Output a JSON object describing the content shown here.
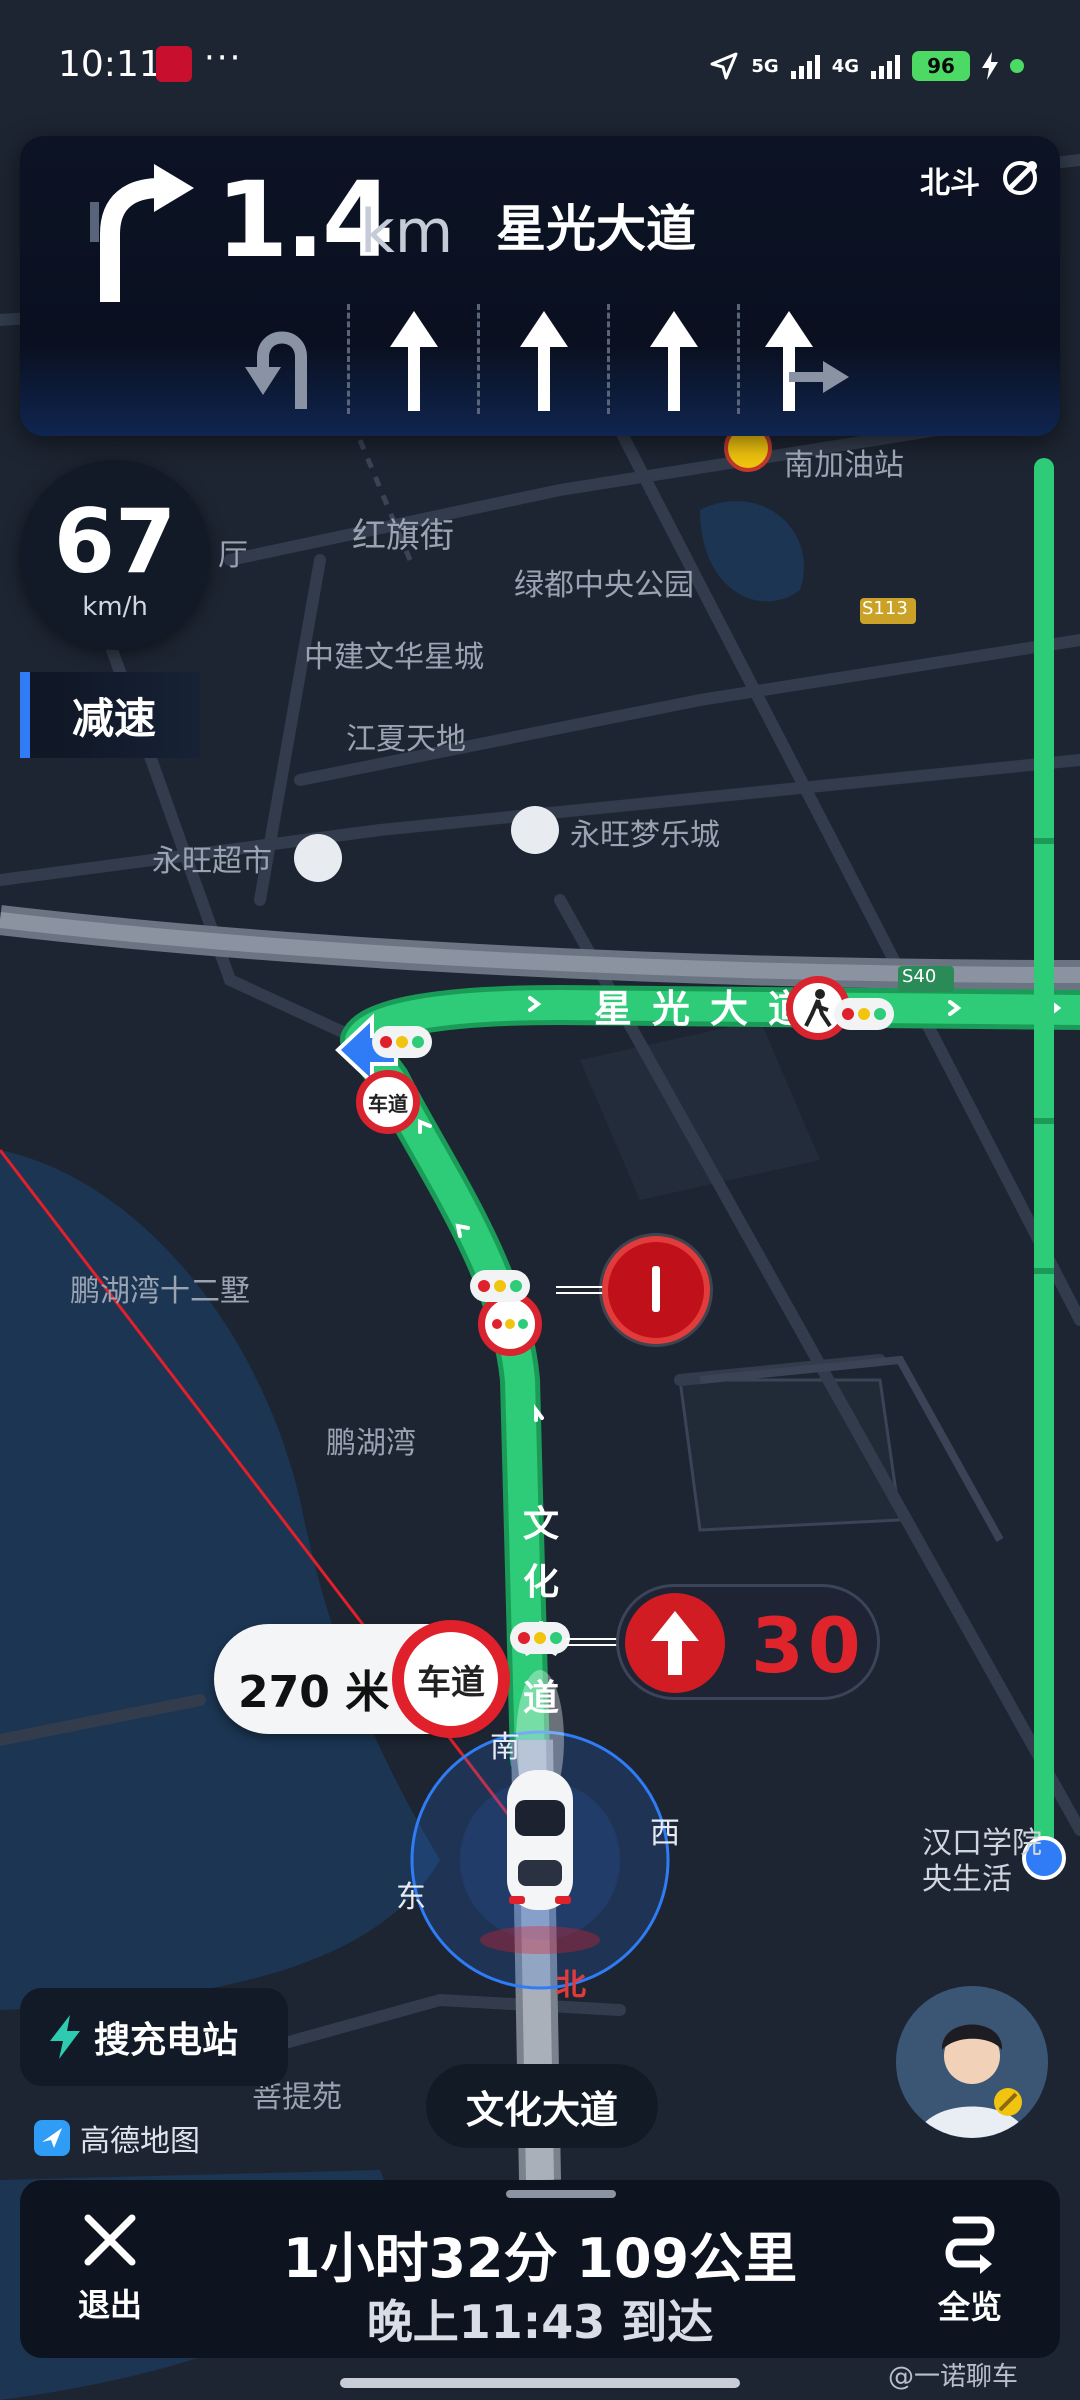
{
  "status_bar": {
    "time": "10:11",
    "app_badge": "招商证券",
    "more": "···",
    "net1": "5G",
    "net2": "4G",
    "battery": "96"
  },
  "guidance": {
    "distance": "1.4",
    "distance_unit": "km",
    "next_road": "星光大道",
    "positioning": "北斗",
    "lanes": [
      "u-turn",
      "straight",
      "straight",
      "straight",
      "straight-right"
    ]
  },
  "speed": {
    "value": "67",
    "unit": "km/h",
    "alert": "减速"
  },
  "map_labels": {
    "gas_station": "南加油站",
    "hongqi_street": "红旗街",
    "hall": "厅",
    "lvdu_park": "绿都中央公园",
    "zhongjian": "中建文华星城",
    "jiangxia": "江夏天地",
    "yongwang_super": "永旺超市",
    "yongwang_mall": "永旺梦乐城",
    "penghu_12": "鹏湖湾十二墅",
    "penghu": "鹏湖湾",
    "hankou": "汉口学院",
    "central": "央生活",
    "puti": "菩提苑",
    "s113": "S113",
    "s40": "S40",
    "road_v": "文化大道",
    "road_h": "星光大道"
  },
  "compass": {
    "north": "北",
    "south": "南",
    "east": "东",
    "west": "西"
  },
  "markers": {
    "lane_sign": "车道",
    "distance_to_lane": "270",
    "distance_unit": "米",
    "speed_limit": "30"
  },
  "actions": {
    "charge": "搜充电站",
    "logo": "高德地图",
    "current_road": "文化大道"
  },
  "trip": {
    "remaining": "1小时32分  109公里",
    "eta": "晚上11:43 到达",
    "exit": "退出",
    "overview": "全览"
  },
  "watermark": "@一诺聊车",
  "colors": {
    "route": "#2ecb78",
    "accent": "#2f7cf6",
    "warning": "#d11c24"
  }
}
